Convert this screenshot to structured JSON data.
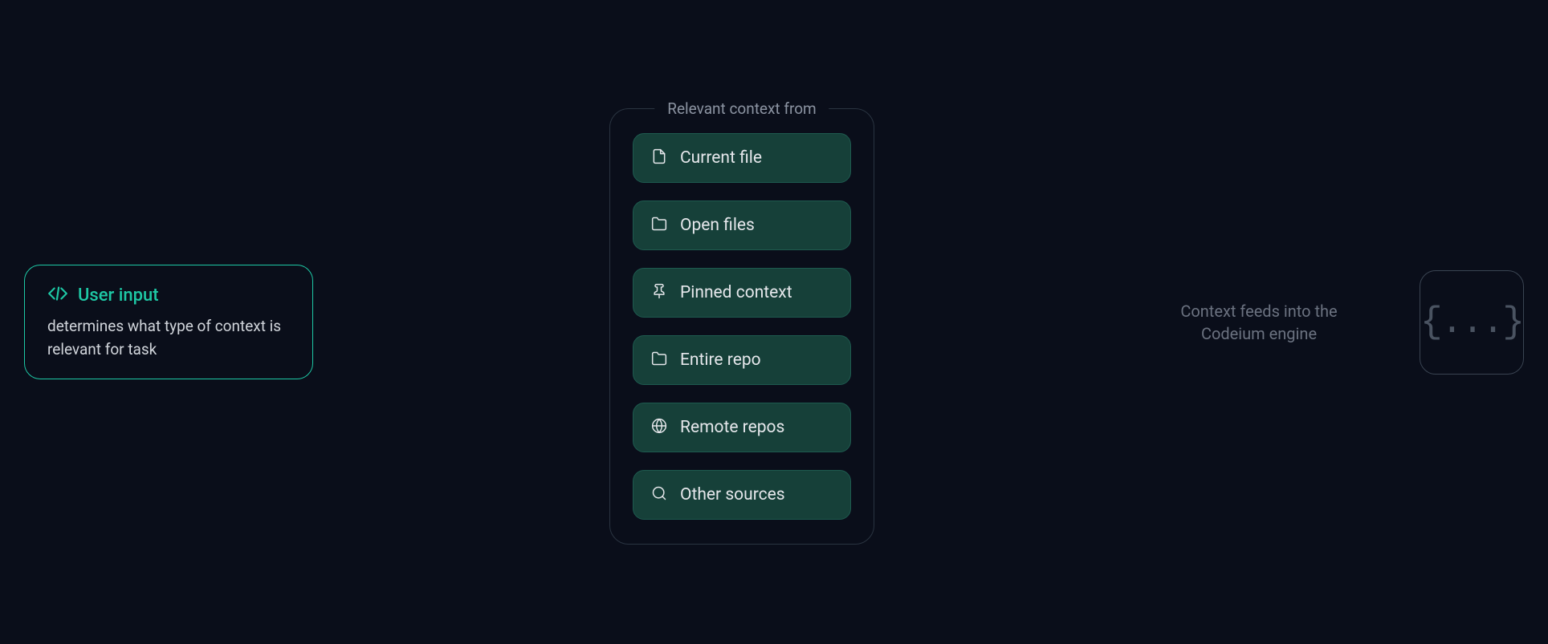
{
  "userInput": {
    "title": "User input",
    "description": "determines what type of context is relevant for task"
  },
  "contextPanel": {
    "title": "Relevant context from",
    "items": [
      {
        "icon": "file",
        "label": "Current file"
      },
      {
        "icon": "folder",
        "label": "Open files"
      },
      {
        "icon": "pin",
        "label": "Pinned context"
      },
      {
        "icon": "folder",
        "label": "Entire repo"
      },
      {
        "icon": "globe",
        "label": "Remote repos"
      },
      {
        "icon": "search",
        "label": "Other sources"
      }
    ]
  },
  "engine": {
    "text": "Context feeds into the Codeium engine",
    "iconText": "{...}"
  },
  "colors": {
    "accent": "#1ec8a5",
    "itemBg": "#164039",
    "textMuted": "#6b7280"
  }
}
